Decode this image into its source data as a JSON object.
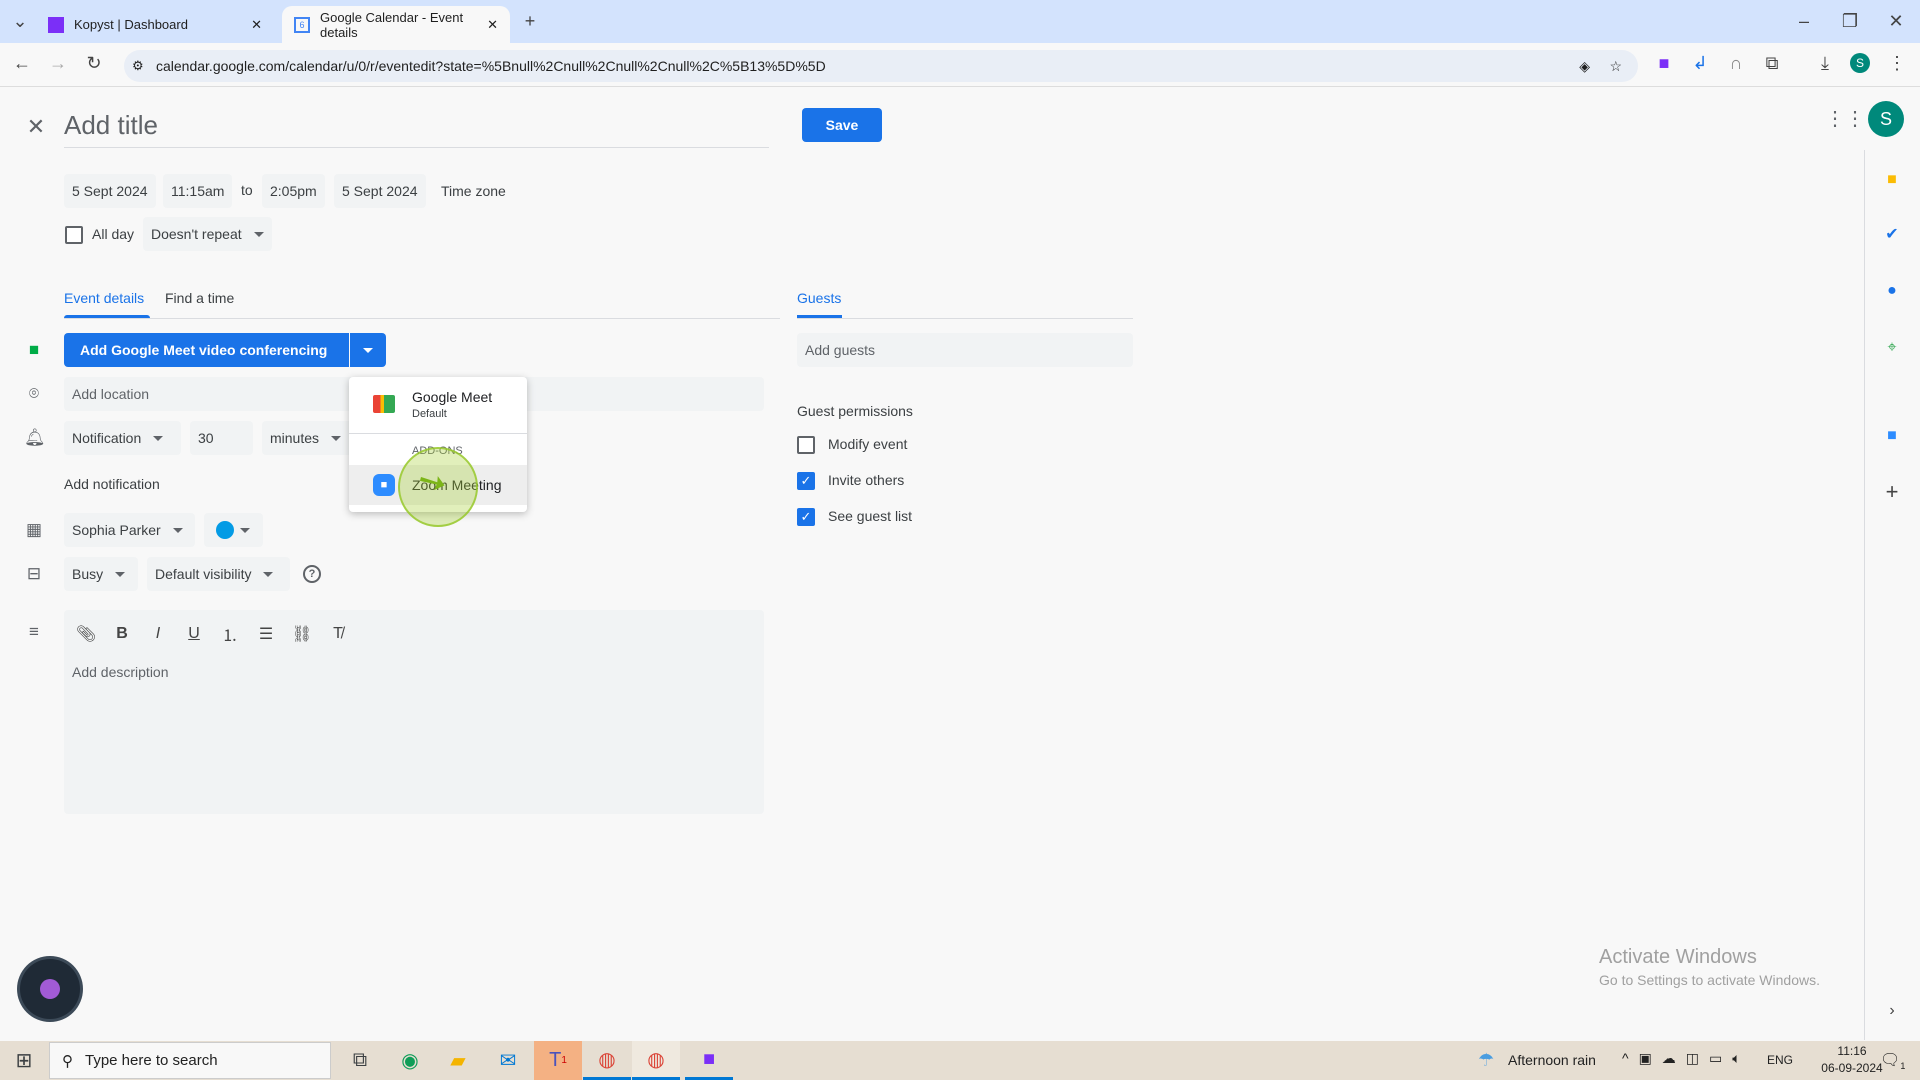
{
  "browser": {
    "tabs": [
      {
        "title": "Kopyst | Dashboard",
        "active": false,
        "icon": "kopyst-icon"
      },
      {
        "title": "Google Calendar - Event details",
        "active": true,
        "icon": "google-calendar-icon"
      }
    ],
    "url": "calendar.google.com/calendar/u/0/r/eventedit?state=%5Bnull%2Cnull%2Cnull%2Cnull%2C%5B13%5D%5D",
    "profile_initial": "S"
  },
  "event": {
    "title_placeholder": "Add title",
    "save_label": "Save",
    "start_date": "5 Sept 2024",
    "start_time": "11:15am",
    "to": "to",
    "end_time": "2:05pm",
    "end_date": "5 Sept 2024",
    "time_zone": "Time zone",
    "all_day": "All day",
    "all_day_checked": false,
    "repeat": "Doesn't repeat",
    "tabs": [
      "Event details",
      "Find a time"
    ],
    "meet_button": "Add Google Meet video conferencing",
    "location_placeholder": "Add location",
    "notification": {
      "type": "Notification",
      "value": "30",
      "unit": "minutes"
    },
    "add_notification": "Add notification",
    "calendar": "Sophia Parker",
    "color": "#039be5",
    "availability": "Busy",
    "visibility": "Default visibility",
    "description_placeholder": "Add description"
  },
  "conference_menu": {
    "items": [
      {
        "title": "Google Meet",
        "subtitle": "Default"
      }
    ],
    "section": "ADD-ONS",
    "addons": [
      {
        "title": "Zoom Meeting"
      }
    ]
  },
  "guests": {
    "tab": "Guests",
    "placeholder": "Add guests",
    "permissions_title": "Guest permissions",
    "permissions": [
      {
        "label": "Modify event",
        "checked": false
      },
      {
        "label": "Invite others",
        "checked": true
      },
      {
        "label": "See guest list",
        "checked": true
      }
    ]
  },
  "watermark": {
    "line1": "Activate Windows",
    "line2": "Go to Settings to activate Windows."
  },
  "taskbar": {
    "search_placeholder": "Type here to search",
    "weather": "Afternoon rain",
    "lang": "ENG",
    "time": "11:16",
    "date": "06-09-2024",
    "notifications": "1",
    "teams_badge": "1"
  },
  "colors": {
    "accent": "#1a73e8",
    "avatar": "#00897b"
  }
}
